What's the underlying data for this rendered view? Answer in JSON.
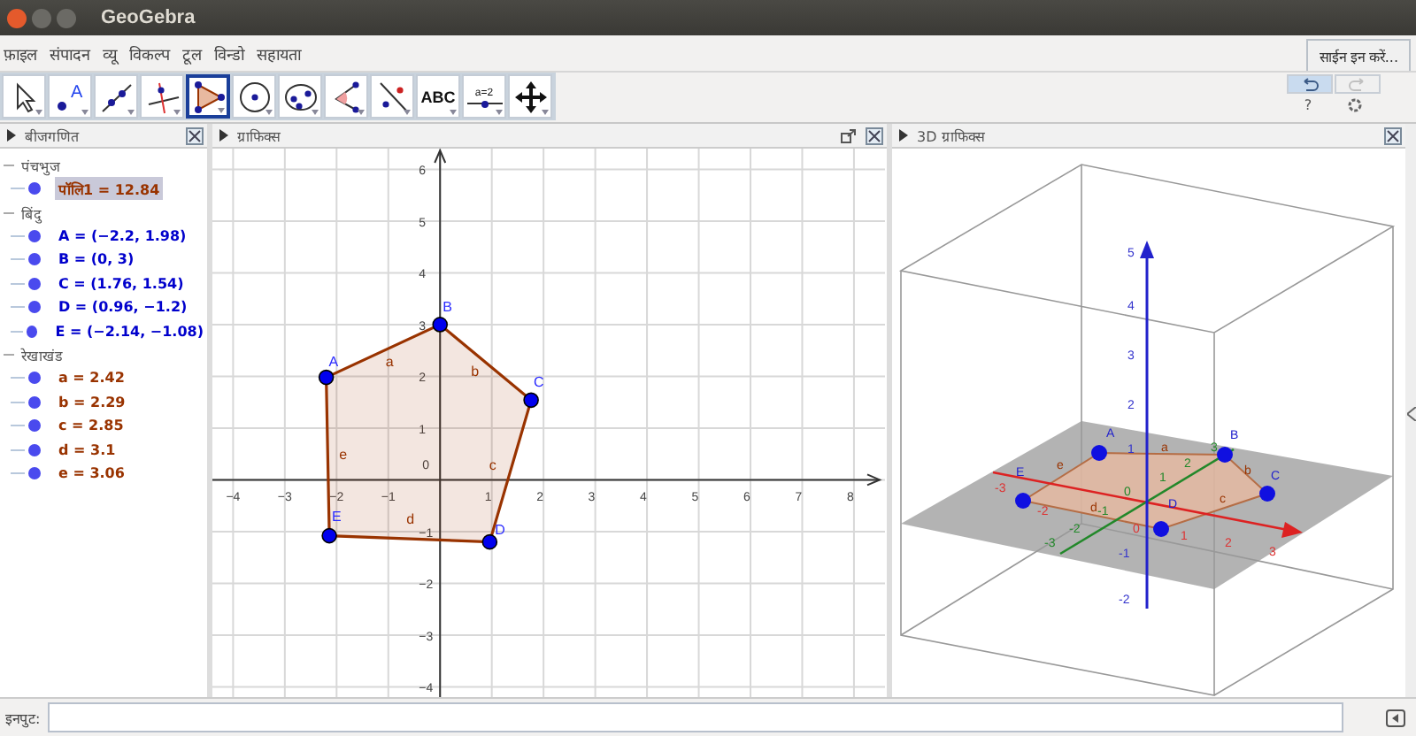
{
  "window": {
    "title": "GeoGebra"
  },
  "menu": [
    "फ़ाइल",
    "संपादन",
    "व्यू",
    "विकल्प",
    "टूल",
    "विन्डो",
    "सहायता"
  ],
  "sign_in": "साईन इन करें...",
  "tools": [
    {
      "kind": "move",
      "selected": false
    },
    {
      "kind": "point",
      "label": "A",
      "selected": false
    },
    {
      "kind": "line",
      "selected": false
    },
    {
      "kind": "perpendicular",
      "selected": false
    },
    {
      "kind": "polygon",
      "selected": true
    },
    {
      "kind": "circle",
      "selected": false
    },
    {
      "kind": "ellipse",
      "selected": false
    },
    {
      "kind": "angle",
      "selected": false
    },
    {
      "kind": "reflect",
      "selected": false
    },
    {
      "kind": "text",
      "label": "ABC",
      "selected": false
    },
    {
      "kind": "slider",
      "label": "a=2",
      "selected": false
    },
    {
      "kind": "move-view",
      "selected": false
    }
  ],
  "undo": {
    "disabled": false
  },
  "redo": {
    "disabled": true
  },
  "help": "?",
  "algebra": {
    "title": "बीजगणित",
    "groups": [
      {
        "name": "पंचभुज",
        "color": "#993300",
        "items": [
          {
            "text": "पॉलि1 = 12.84",
            "selected": true
          }
        ]
      },
      {
        "name": "बिंदु",
        "color": "#0000cc",
        "items": [
          {
            "text": "A = (−2.2, 1.98)",
            "selected": false
          },
          {
            "text": "B = (0, 3)",
            "selected": false
          },
          {
            "text": "C = (1.76, 1.54)",
            "selected": false
          },
          {
            "text": "D = (0.96, −1.2)",
            "selected": false
          },
          {
            "text": "E = (−2.14, −1.08)",
            "selected": false
          }
        ]
      },
      {
        "name": "रेखाखंड",
        "color": "#993300",
        "items": [
          {
            "text": "a = 2.42",
            "selected": false
          },
          {
            "text": "b = 2.29",
            "selected": false
          },
          {
            "text": "c = 2.85",
            "selected": false
          },
          {
            "text": "d = 3.1",
            "selected": false
          },
          {
            "text": "e = 3.06",
            "selected": false
          }
        ]
      }
    ]
  },
  "graphics": {
    "title": "ग्राफिक्स",
    "chart_data": {
      "type": "scatter",
      "x": [
        -2.2,
        0,
        1.76,
        0.96,
        -2.14
      ],
      "series": [
        {
          "color": "#0000ee",
          "values": [
            1.98,
            3,
            1.54,
            -1.2,
            -1.08
          ]
        }
      ],
      "grid": true,
      "xlim": [
        -4.4,
        8.6
      ],
      "ylim": [
        -4.3,
        6.4
      ],
      "xticks": [
        -4,
        -3,
        -2,
        -1,
        1,
        2,
        3,
        4,
        5,
        6,
        7,
        8
      ],
      "yticks": [
        -4,
        -3,
        -2,
        -1,
        1,
        2,
        3,
        4,
        5,
        6
      ]
    },
    "origin_label": "0",
    "point_labels": [
      "A",
      "B",
      "C",
      "D",
      "E"
    ],
    "segment_labels": [
      "a",
      "b",
      "c",
      "d",
      "e"
    ]
  },
  "view_3d": {
    "title": "3D ग्राफिक्स",
    "z_ticks": [
      "5",
      "4",
      "3",
      "2",
      "1",
      "-1",
      "-2"
    ],
    "x_ticks": [
      "-3",
      "-2",
      "0",
      "1",
      "2",
      "3"
    ],
    "y_ticks": [
      "-3",
      "-2",
      "-1",
      "0",
      "1",
      "2",
      "3"
    ],
    "point_labels": [
      "E",
      "A",
      "D",
      "B",
      "C"
    ],
    "segment_labels": [
      "e",
      "d",
      "a",
      "c",
      "b"
    ]
  },
  "input_bar": {
    "label": "इनपुट:"
  }
}
